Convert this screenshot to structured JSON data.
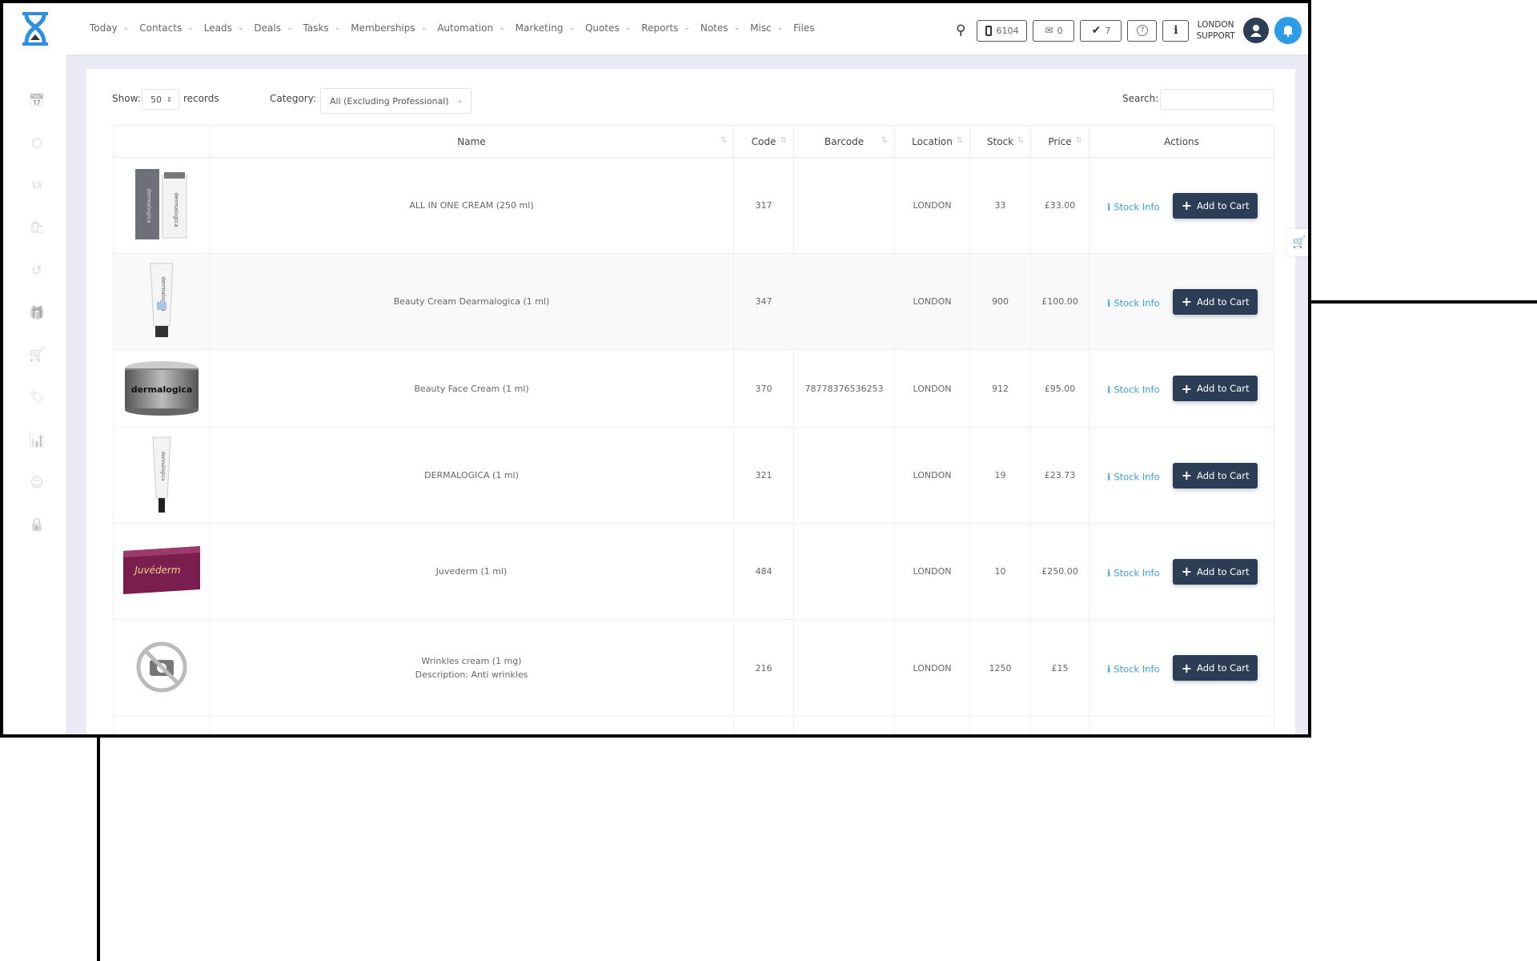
{
  "nav": [
    "Today",
    "Contacts",
    "Leads",
    "Deals",
    "Tasks",
    "Memberships",
    "Automation",
    "Marketing",
    "Quotes",
    "Reports",
    "Notes",
    "Misc",
    "Files"
  ],
  "nav_has_dropdown": [
    true,
    true,
    true,
    true,
    true,
    true,
    true,
    true,
    true,
    true,
    true,
    true,
    false
  ],
  "header": {
    "phone_count": "6104",
    "mail_count": "0",
    "tasks_count": "7",
    "user_line1": "LONDON",
    "user_line2": "SUPPORT"
  },
  "sidebar_icons": [
    "calendar-icon",
    "box-icon",
    "copy-icon",
    "basket-icon",
    "history-icon",
    "gift-icon",
    "cart-icon",
    "tags-icon",
    "report-icon",
    "user-circle-icon",
    "lock-icon"
  ],
  "controls": {
    "show_label": "Show:",
    "show_value": "50",
    "records_label": "records",
    "category_label": "Category:",
    "category_value": "All (Excluding Professional)",
    "search_label": "Search:",
    "search_value": ""
  },
  "columns": [
    "",
    "Name",
    "Code",
    "Barcode",
    "Location",
    "Stock",
    "Price",
    "Actions"
  ],
  "rows": [
    {
      "image": "dark-box-tube",
      "name": "ALL IN ONE CREAM (250 ml)",
      "description": "",
      "code": "317",
      "barcode": "",
      "location": "LONDON",
      "stock": "33",
      "price": "£33.00"
    },
    {
      "image": "white-tube",
      "name": "Beauty Cream Dearmalogica (1 ml)",
      "description": "",
      "code": "347",
      "barcode": "",
      "location": "LONDON",
      "stock": "900",
      "price": "£100.00"
    },
    {
      "image": "silver-tin",
      "name": "Beauty Face Cream (1 ml)",
      "description": "",
      "code": "370",
      "barcode": "78778376536253",
      "location": "LONDON",
      "stock": "912",
      "price": "£95.00"
    },
    {
      "image": "thin-tube",
      "name": "DERMALOGICA (1 ml)",
      "description": "",
      "code": "321",
      "barcode": "",
      "location": "LONDON",
      "stock": "19",
      "price": "£23.73"
    },
    {
      "image": "purple-box",
      "name": "Juvederm (1 ml)",
      "description": "",
      "code": "484",
      "barcode": "",
      "location": "LONDON",
      "stock": "10",
      "price": "£250.00"
    },
    {
      "image": "no-image",
      "name": "Wrinkles cream (1 mg)",
      "description": "Description: Anti wrinkles",
      "code": "216",
      "barcode": "",
      "location": "LONDON",
      "stock": "1250",
      "price": "£15"
    }
  ],
  "actions": {
    "stock_info": "Stock Info",
    "add_to_cart": "Add to Cart"
  },
  "product_label_dermalogica": "dermalogica",
  "product_label_juvederm": "Juvéderm",
  "colors": {
    "button": "#2c3e55",
    "link": "#3aa0d8",
    "bell": "#2d9be8",
    "logo": "#2d8fe0",
    "avatar": "#2c3e55"
  }
}
